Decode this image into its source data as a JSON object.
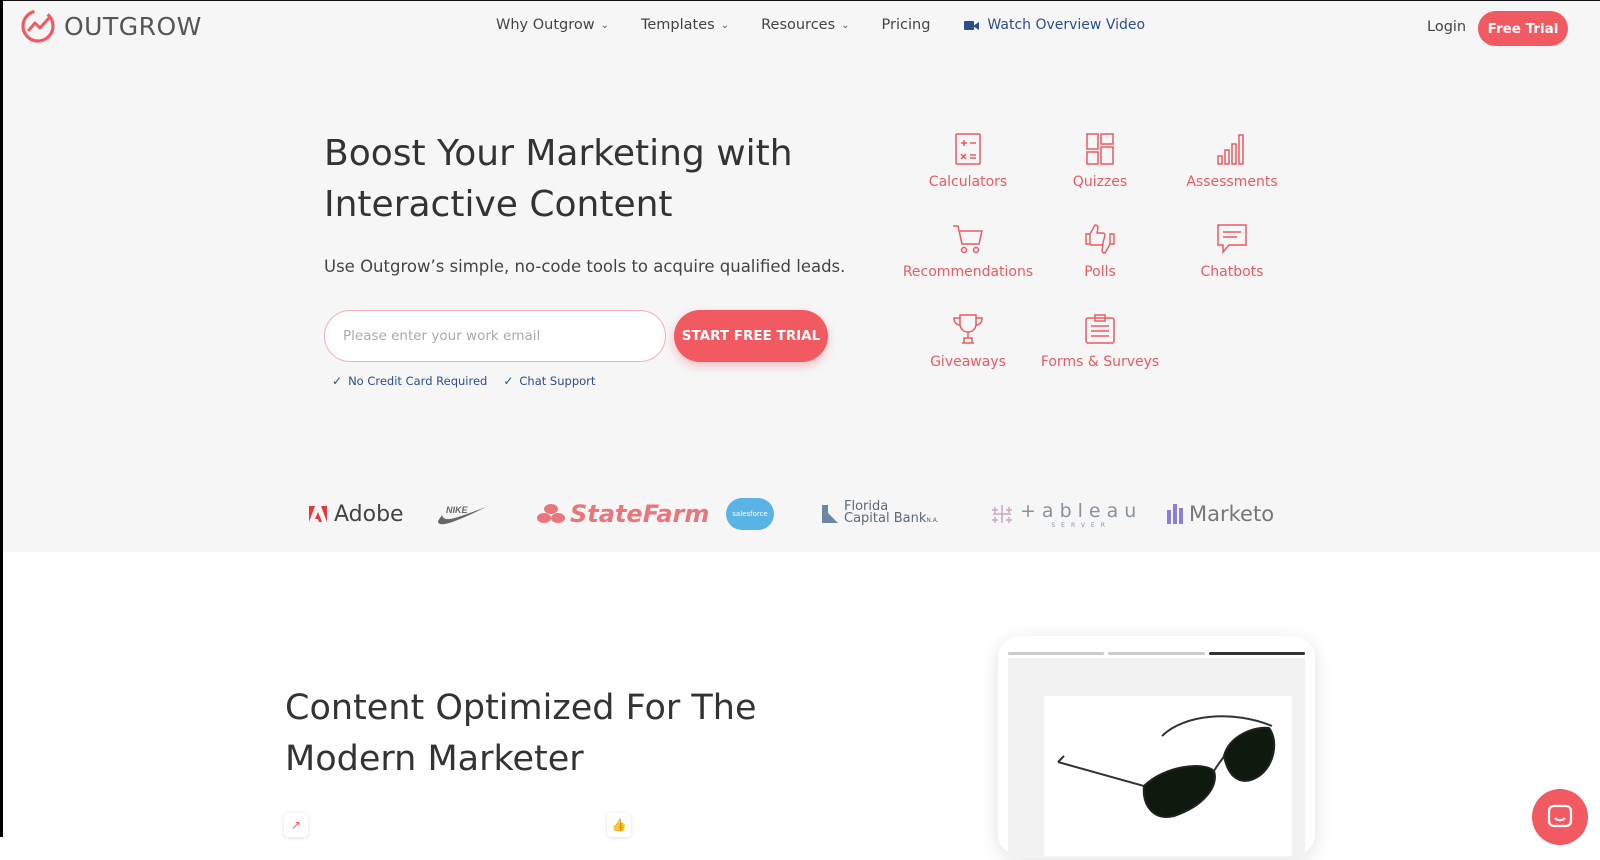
{
  "brand": {
    "name": "OUTGROW",
    "accent": "#f25a62",
    "link_color": "#2b4f8a"
  },
  "nav": {
    "items": [
      {
        "label": "Why Outgrow",
        "dropdown": true
      },
      {
        "label": "Templates",
        "dropdown": true
      },
      {
        "label": "Resources",
        "dropdown": true
      },
      {
        "label": "Pricing",
        "dropdown": false
      }
    ],
    "video_label": "Watch Overview Video",
    "login_label": "Login",
    "free_trial_label": "Free Trial"
  },
  "hero": {
    "title": "Boost Your Marketing with Interactive Content",
    "subtitle": "Use Outgrow’s simple, no-code tools to acquire qualified leads.",
    "email_placeholder": "Please enter your work email",
    "cta_label": "START FREE TRIAL",
    "checks": [
      "No Credit Card Required",
      "Chat Support"
    ]
  },
  "content_types": [
    {
      "label": "Calculators",
      "icon": "calculator-icon"
    },
    {
      "label": "Quizzes",
      "icon": "quiz-grid-icon"
    },
    {
      "label": "Assessments",
      "icon": "bar-chart-icon"
    },
    {
      "label": "Recommendations",
      "icon": "cart-icon"
    },
    {
      "label": "Polls",
      "icon": "thumbs-icon"
    },
    {
      "label": "Chatbots",
      "icon": "chat-icon"
    },
    {
      "label": "Giveaways",
      "icon": "trophy-icon"
    },
    {
      "label": "Forms & Surveys",
      "icon": "clipboard-icon"
    }
  ],
  "client_logos": {
    "adobe": "Adobe",
    "nike": "NIKE",
    "statefarm": "StateFarm",
    "salesforce": "salesforce",
    "florida_1": "Florida",
    "florida_2": "Capital Bank",
    "florida_3": "N.A.",
    "tableau": "+ableau",
    "tableau_sub": "SERVER",
    "marketo": "Marketo"
  },
  "section2": {
    "title": "Content Optimized For The Modern Marketer"
  }
}
